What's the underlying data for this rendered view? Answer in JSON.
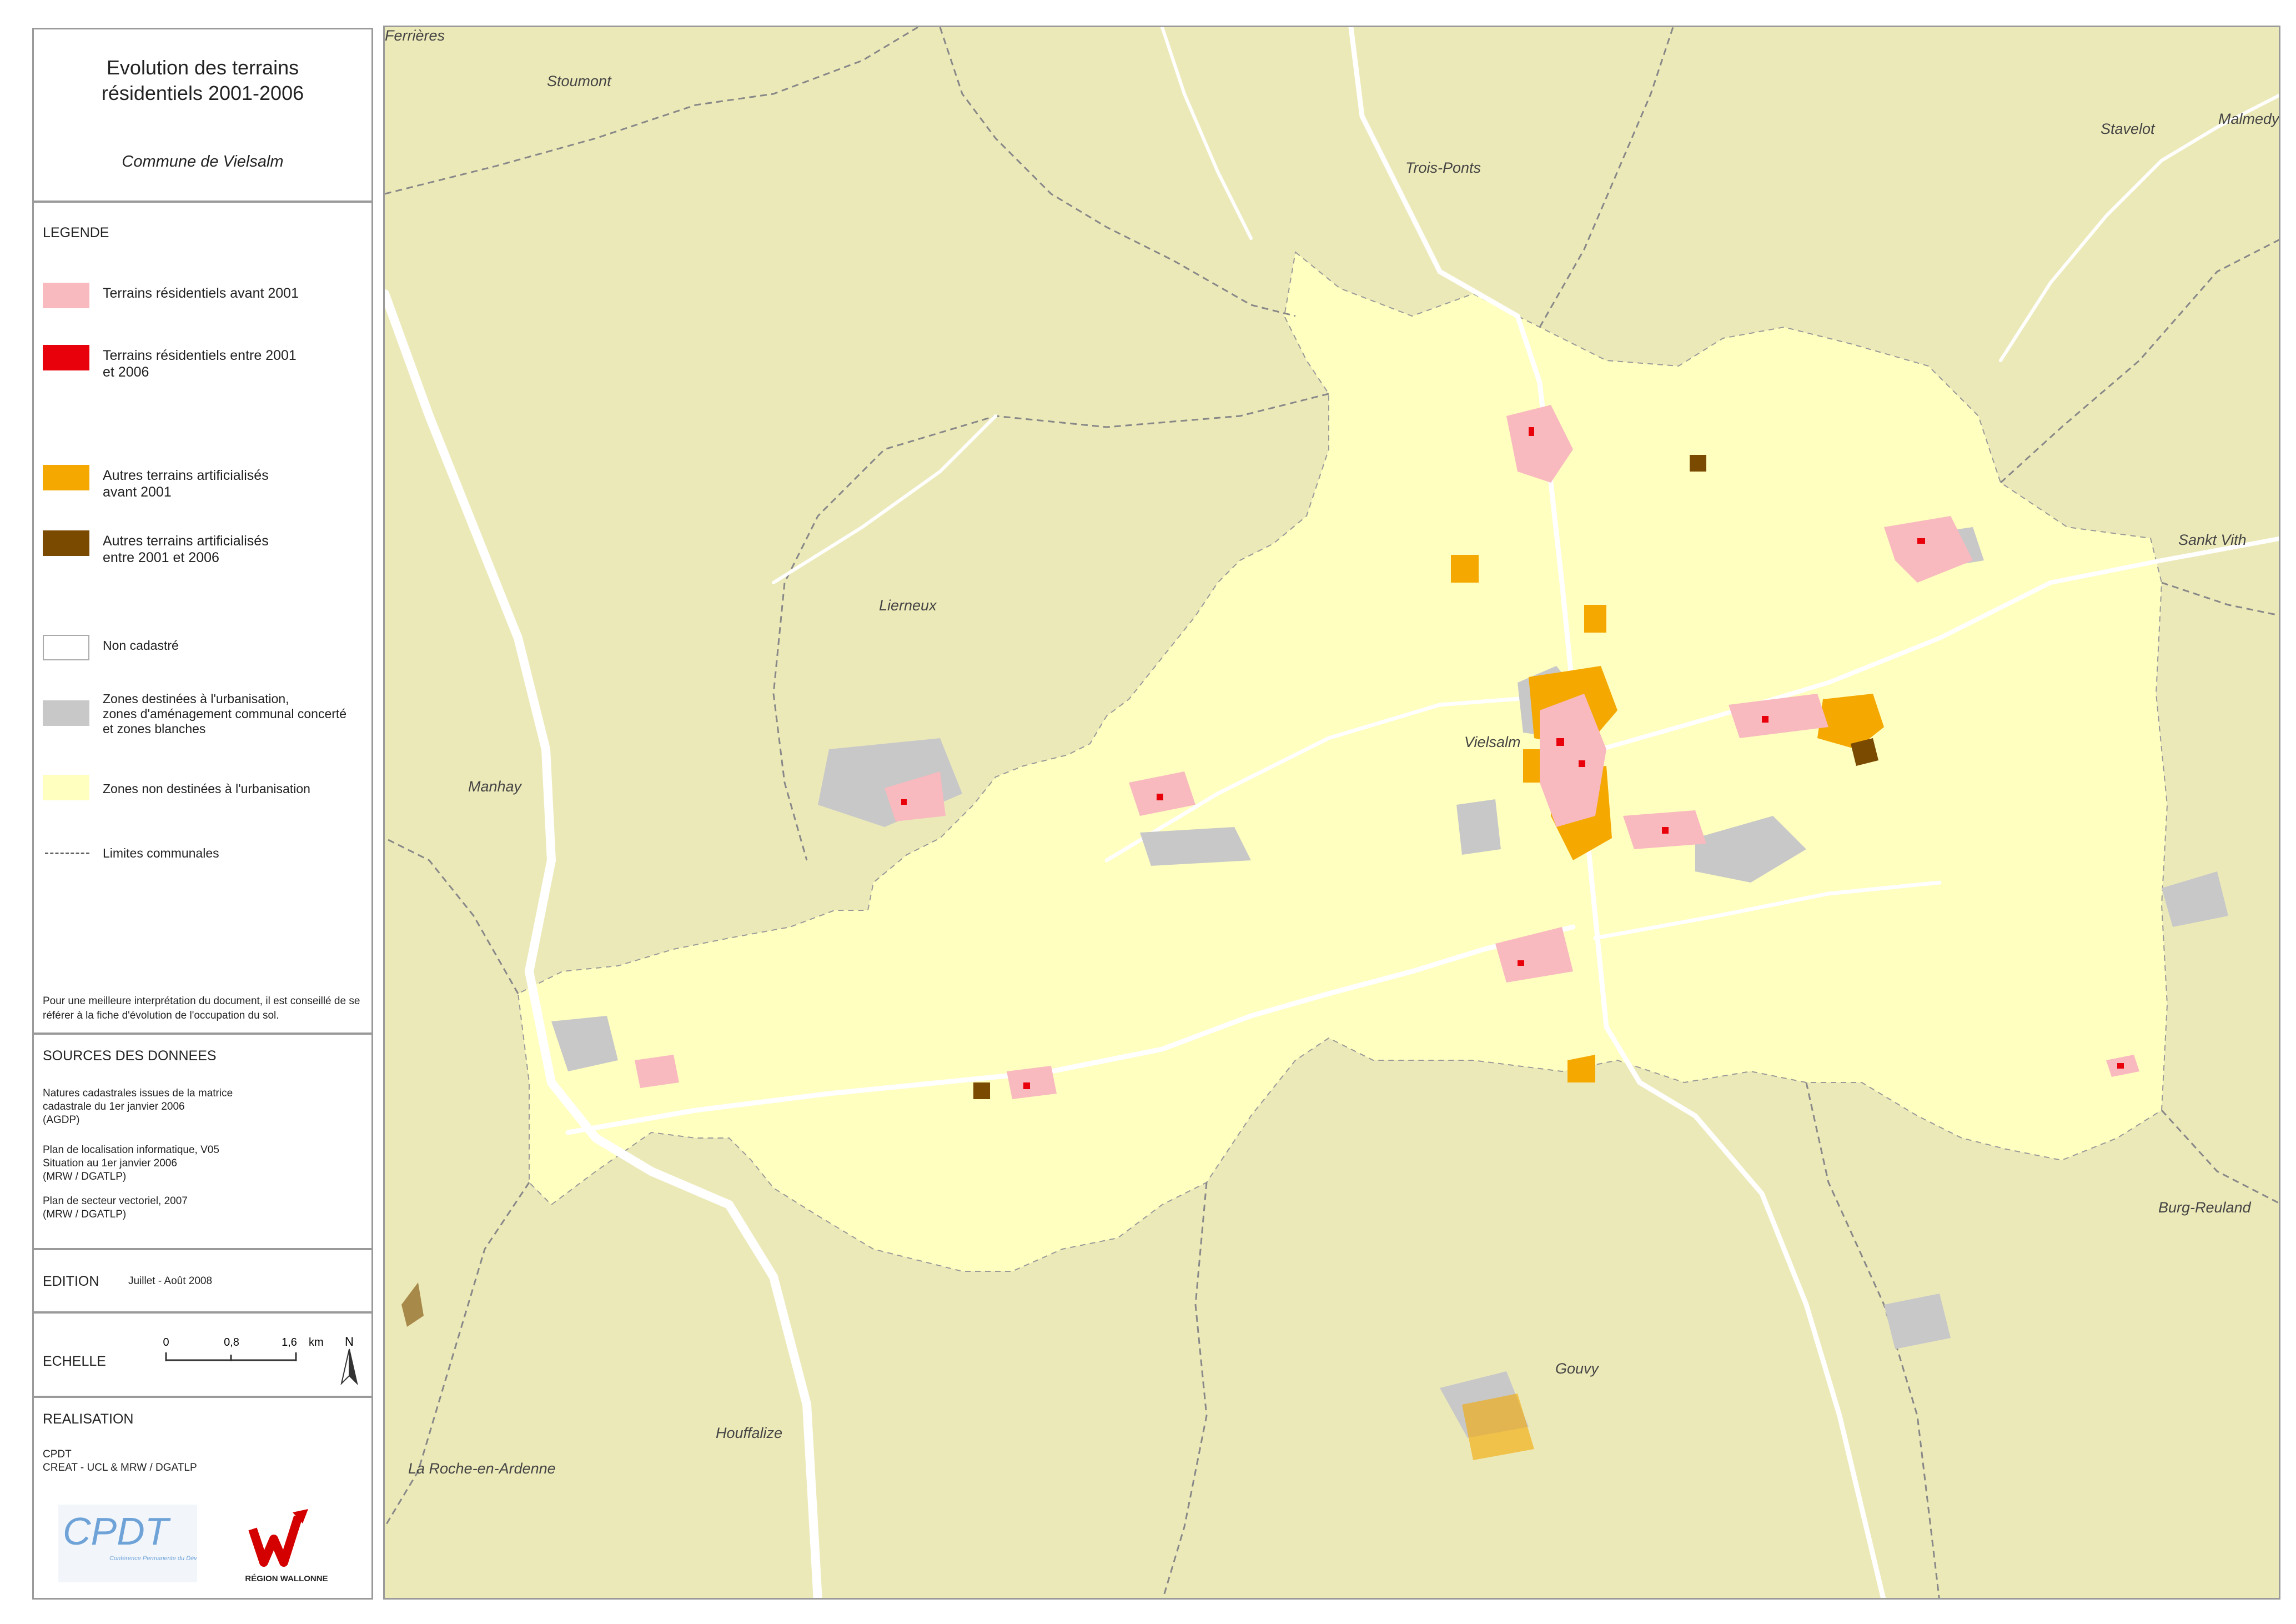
{
  "title": {
    "line1": "Evolution des terrains",
    "line2": "résidentiels 2001-2006",
    "commune": "Commune de Vielsalm"
  },
  "legend": {
    "heading": "LEGENDE",
    "items": [
      {
        "label": "Terrains résidentiels avant 2001",
        "color": "#f8b9bf"
      },
      {
        "label": "Terrains résidentiels entre 2001\net 2006",
        "color": "#e8000b"
      },
      {
        "label": "Autres terrains artificialisés\navant 2001",
        "color": "#f5a800"
      },
      {
        "label": "Autres terrains artificialisés\nentre 2001 et 2006",
        "color": "#7a4a00"
      },
      {
        "label": "Non cadastré",
        "color": "#ffffff"
      },
      {
        "label": "Zones destinées à l'urbanisation,\nzones d'aménagement communal concerté\net zones blanches",
        "color": "#c8c8c8"
      },
      {
        "label": "Zones non destinées à l'urbanisation",
        "color": "#ffffc0"
      },
      {
        "label": "Limites communales",
        "color": "#666666"
      }
    ],
    "note": "Pour une meilleure interprétation du document, il est conseillé de se référer à la fiche d'évolution de l'occupation du sol."
  },
  "sources": {
    "heading": "SOURCES DES DONNEES",
    "lines": [
      "Natures cadastrales issues de la matrice\ncadastrale du 1er janvier 2006\n(AGDP)",
      "Plan de localisation informatique, V05\nSituation au 1er janvier 2006\n(MRW / DGATLP)",
      "Plan de secteur vectoriel, 2007\n(MRW / DGATLP)"
    ]
  },
  "edition": {
    "heading": "EDITION",
    "value": "Juillet - Août 2008"
  },
  "scale": {
    "heading": "ECHELLE",
    "ticks": [
      "0",
      "0,8",
      "1,6"
    ],
    "unit": "km",
    "north": "N"
  },
  "realisation": {
    "heading": "REALISATION",
    "line1": "CPDT",
    "line2": "CREAT - UCL & MRW / DGATLP",
    "logo1": "CPDT",
    "logo1_sub": "Conférence Permanente du Développement Territorial",
    "logo2_sub": "RÉGION WALLONNE"
  },
  "map": {
    "places": [
      {
        "name": "Ferrières"
      },
      {
        "name": "Stoumont"
      },
      {
        "name": "Trois-Ponts"
      },
      {
        "name": "Stavelot"
      },
      {
        "name": "Malmedy"
      },
      {
        "name": "Sankt Vith"
      },
      {
        "name": "Lierneux"
      },
      {
        "name": "Vielsalm"
      },
      {
        "name": "Manhay"
      },
      {
        "name": "Burg-Reuland"
      },
      {
        "name": "Gouvy"
      },
      {
        "name": "Houffalize"
      },
      {
        "name": "La Roche-en-Ardenne"
      }
    ],
    "colors": {
      "background": "#ece9b9",
      "commune_fill": "#ffffc0",
      "residential_old": "#f8b9bf",
      "residential_new": "#e8000b",
      "artificial_old": "#f5a800",
      "artificial_new": "#7a4a00",
      "urbanisable": "#c8c8c8",
      "roads": "#ffffff",
      "boundary": "#777777"
    }
  }
}
